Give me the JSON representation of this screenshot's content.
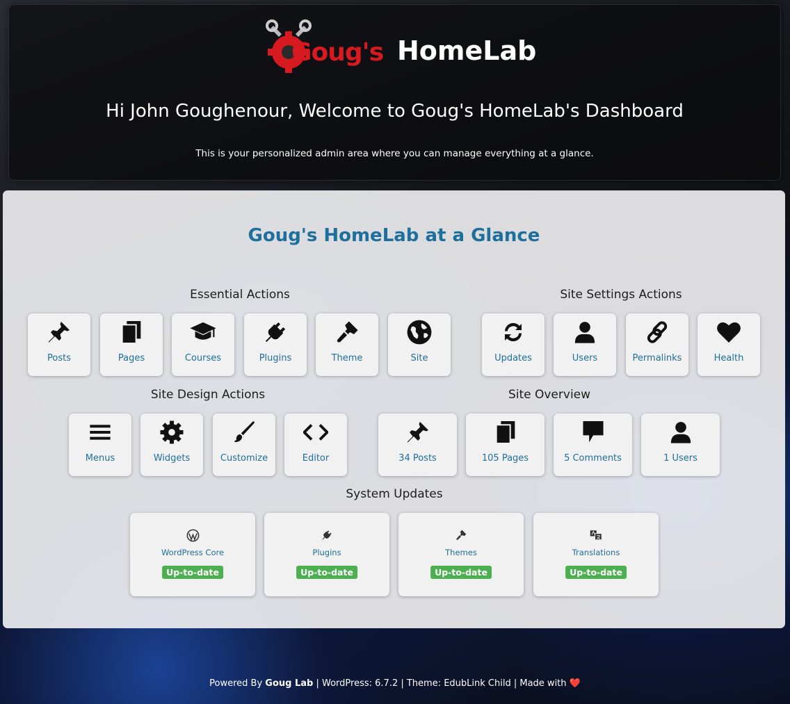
{
  "header": {
    "logo_red": "Goug's",
    "logo_white": "HomeLab",
    "welcome": "Hi John Goughenour, Welcome to Goug's HomeLab's Dashboard",
    "subtitle": "This is your personalized admin area where you can manage everything at a glance."
  },
  "panel": {
    "title": "Goug's HomeLab at a Glance",
    "essential": {
      "title": "Essential Actions",
      "items": [
        {
          "label": "Posts",
          "icon": "pin-icon"
        },
        {
          "label": "Pages",
          "icon": "pages-icon"
        },
        {
          "label": "Courses",
          "icon": "graduation-cap-icon"
        },
        {
          "label": "Plugins",
          "icon": "plug-icon"
        },
        {
          "label": "Theme",
          "icon": "paintbrush-icon"
        },
        {
          "label": "Site",
          "icon": "globe-icon"
        }
      ]
    },
    "settings": {
      "title": "Site Settings Actions",
      "items": [
        {
          "label": "Updates",
          "icon": "refresh-icon"
        },
        {
          "label": "Users",
          "icon": "user-icon"
        },
        {
          "label": "Permalinks",
          "icon": "link-icon"
        },
        {
          "label": "Health",
          "icon": "heart-icon"
        }
      ]
    },
    "design": {
      "title": "Site Design Actions",
      "items": [
        {
          "label": "Menus",
          "icon": "menu-icon"
        },
        {
          "label": "Widgets",
          "icon": "gear-icon"
        },
        {
          "label": "Customize",
          "icon": "brush-icon"
        },
        {
          "label": "Editor",
          "icon": "code-icon"
        }
      ]
    },
    "overview": {
      "title": "Site Overview",
      "items": [
        {
          "label": "34 Posts",
          "icon": "pin-icon"
        },
        {
          "label": "105 Pages",
          "icon": "pages-icon"
        },
        {
          "label": "5 Comments",
          "icon": "comment-icon"
        },
        {
          "label": "1 Users",
          "icon": "user-icon"
        }
      ]
    },
    "updates": {
      "title": "System Updates",
      "items": [
        {
          "label": "WordPress Core",
          "status": "Up-to-date",
          "icon": "wordpress-icon"
        },
        {
          "label": "Plugins",
          "status": "Up-to-date",
          "icon": "plug-icon"
        },
        {
          "label": "Themes",
          "status": "Up-to-date",
          "icon": "paintbrush-icon"
        },
        {
          "label": "Translations",
          "status": "Up-to-date",
          "icon": "translation-icon"
        }
      ]
    }
  },
  "footer": {
    "powered": "Powered By ",
    "brand": "Goug Lab",
    "rest": " | WordPress: 6.7.2 | Theme: EdubLink Child | Made with ",
    "heart": "❤️"
  },
  "colors": {
    "accent": "#1f6f9c",
    "badge": "#4caf50",
    "logo_red": "#d71920"
  }
}
